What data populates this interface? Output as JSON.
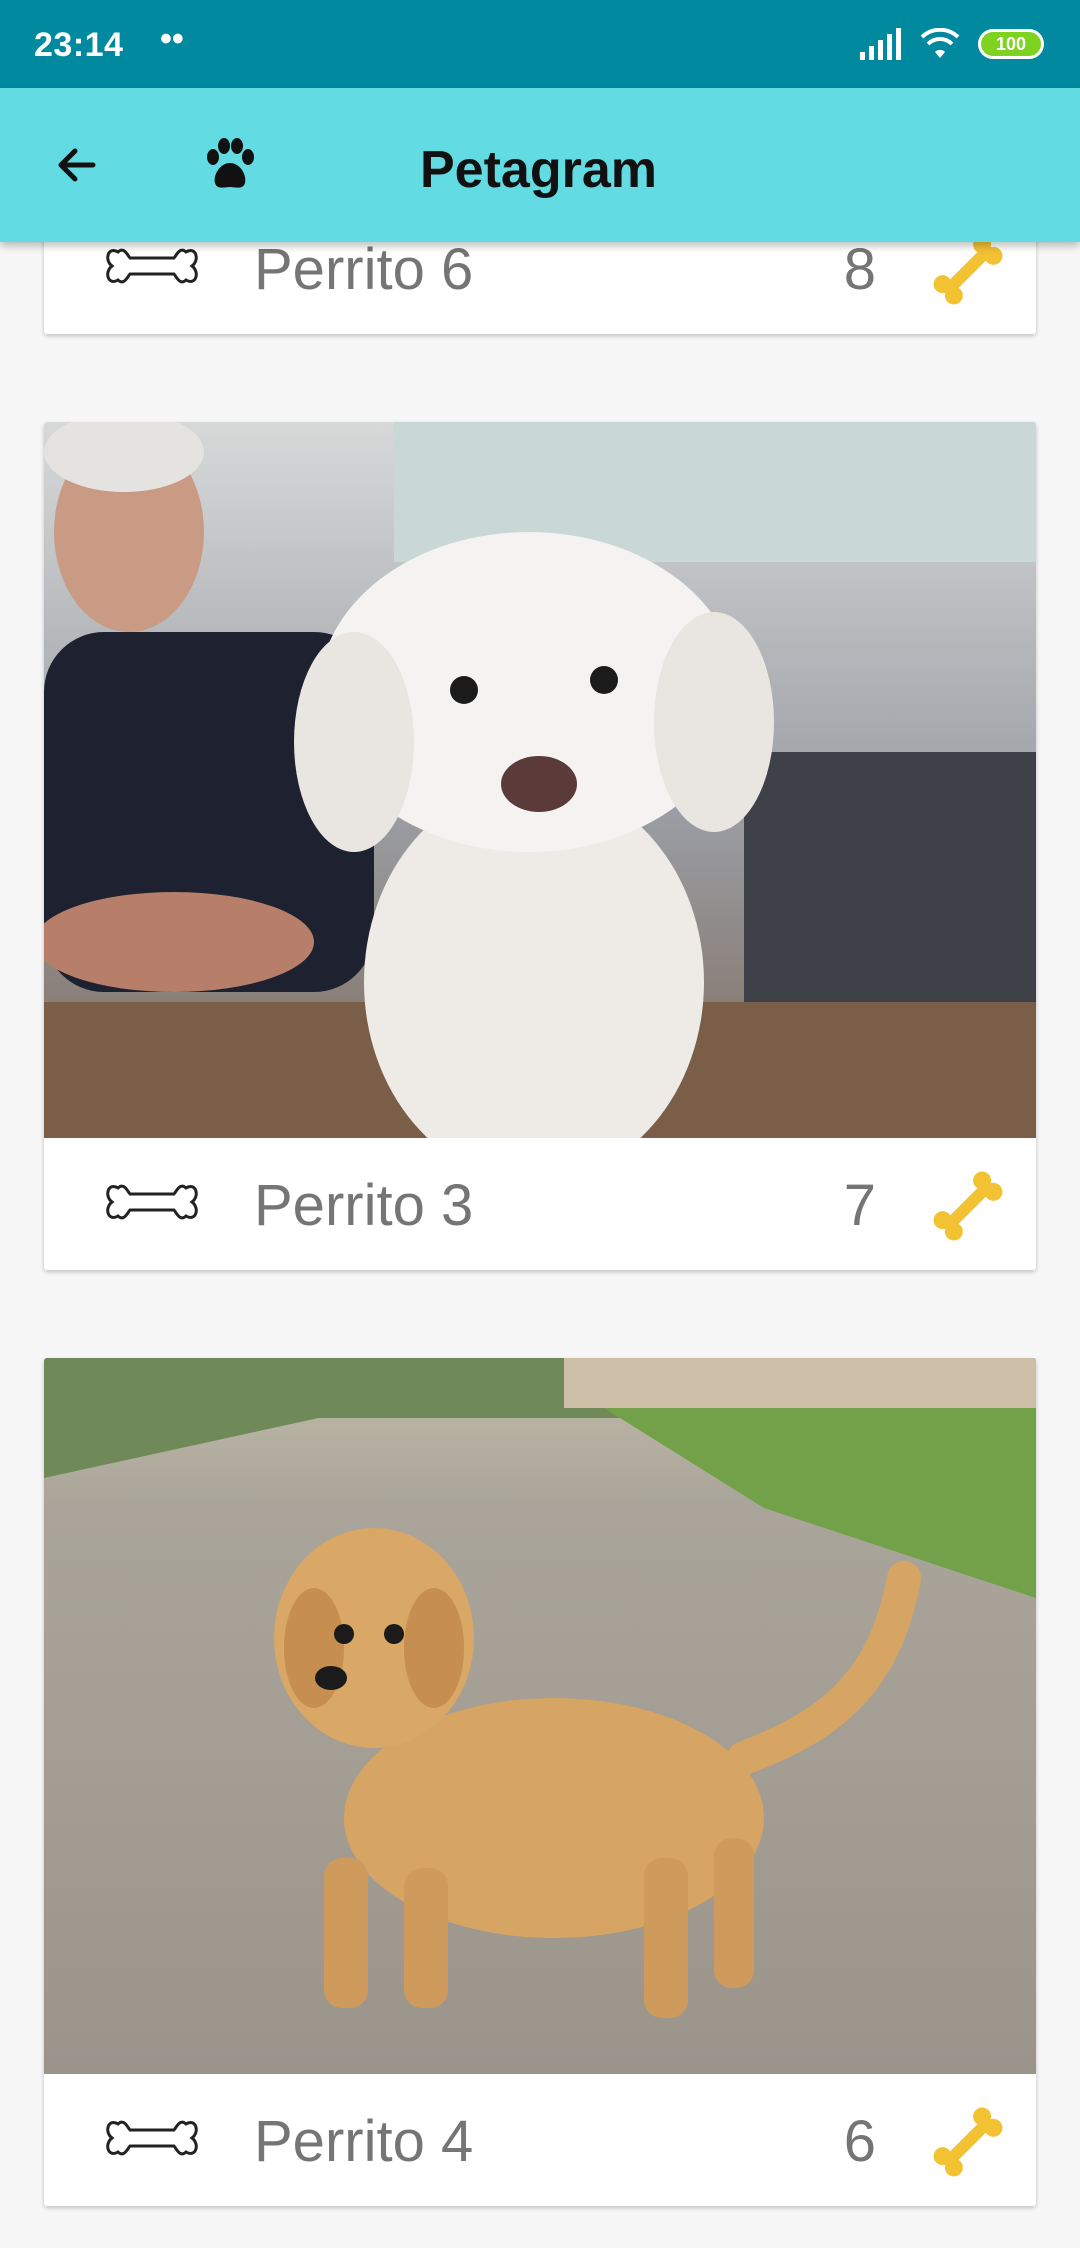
{
  "status_bar": {
    "time": "23:14",
    "dots": "••",
    "battery": "100"
  },
  "toolbar": {
    "title": "Petagram",
    "back_icon": "arrow-left-icon",
    "paw_icon": "paw-icon"
  },
  "pets": [
    {
      "name": "Perrito 6",
      "count": "8"
    },
    {
      "name": "Perrito 3",
      "count": "7"
    },
    {
      "name": "Perrito 4",
      "count": "6"
    }
  ],
  "colors": {
    "status_bar": "#00899f",
    "toolbar": "#62dbe2",
    "bone_gold": "#f3c232"
  }
}
